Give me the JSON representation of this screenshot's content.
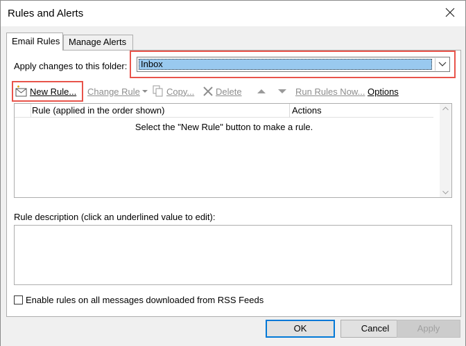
{
  "window": {
    "title": "Rules and Alerts"
  },
  "tabs": [
    {
      "label": "Email Rules"
    },
    {
      "label": "Manage Alerts"
    }
  ],
  "folder": {
    "label": "Apply changes to this folder:",
    "selected": "Inbox"
  },
  "toolbar": {
    "new_rule": "New Rule...",
    "change_rule": "Change Rule",
    "copy": "Copy...",
    "delete": "Delete",
    "run_rules": "Run Rules Now...",
    "options": "Options"
  },
  "rules_table": {
    "columns": [
      "Rule (applied in the order shown)",
      "Actions"
    ],
    "empty_message": "Select the \"New Rule\" button to make a rule."
  },
  "description": {
    "label": "Rule description (click an underlined value to edit):"
  },
  "rss": {
    "label": "Enable rules on all messages downloaded from RSS Feeds",
    "checked": false
  },
  "buttons": {
    "ok": "OK",
    "cancel": "Cancel",
    "apply": "Apply"
  },
  "colors": {
    "highlight": "#e8534a",
    "selection": "#99c9ef",
    "accent": "#0078d7"
  }
}
